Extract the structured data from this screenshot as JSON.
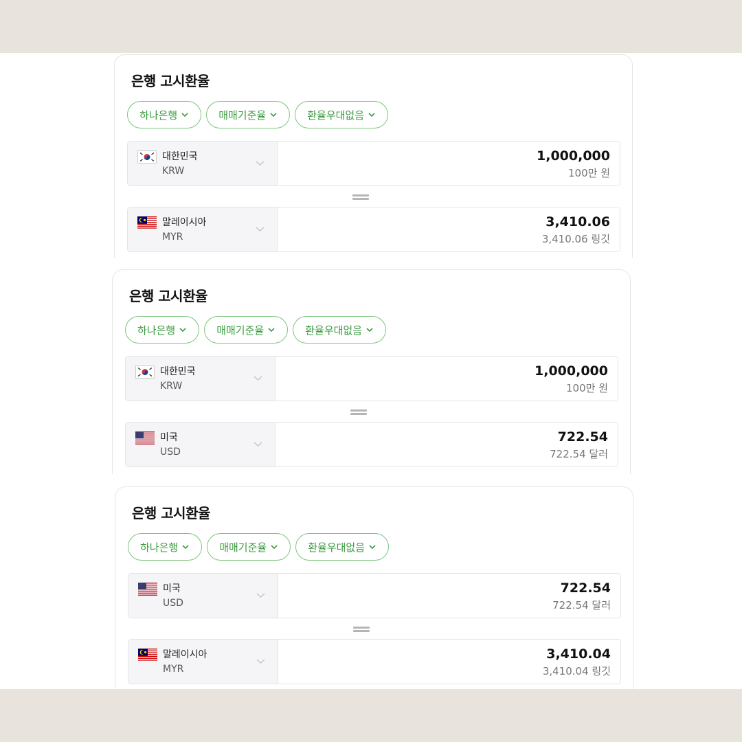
{
  "cards": [
    {
      "title": "은행 고시환율",
      "filters": [
        "하나은행",
        "매매기준율",
        "환율우대없음"
      ],
      "from": {
        "flag": "south-korea-flag-icon",
        "name": "대한민국",
        "code": "KRW",
        "amount": "1,000,000",
        "amount_text": "100만 원"
      },
      "to": {
        "flag": "malaysia-flag-icon",
        "name": "말레이시아",
        "code": "MYR",
        "amount": "3,410.06",
        "amount_text": "3,410.06 링깃"
      }
    },
    {
      "title": "은행 고시환율",
      "filters": [
        "하나은행",
        "매매기준율",
        "환율우대없음"
      ],
      "from": {
        "flag": "south-korea-flag-icon",
        "name": "대한민국",
        "code": "KRW",
        "amount": "1,000,000",
        "amount_text": "100만 원"
      },
      "to": {
        "flag": "usa-flag-icon",
        "name": "미국",
        "code": "USD",
        "amount": "722.54",
        "amount_text": "722.54 달러"
      }
    },
    {
      "title": "은행 고시환율",
      "filters": [
        "하나은행",
        "매매기준율",
        "환율우대없음"
      ],
      "from": {
        "flag": "usa-flag-icon",
        "name": "미국",
        "code": "USD",
        "amount": "722.54",
        "amount_text": "722.54 달러"
      },
      "to": {
        "flag": "malaysia-flag-icon",
        "name": "말레이시아",
        "code": "MYR",
        "amount": "3,410.04",
        "amount_text": "3,410.04 링깃"
      }
    }
  ],
  "colors": {
    "background": "#e8e3dc",
    "chip_border": "#7cc47c",
    "chip_text": "#3a9b3f",
    "select_bg": "#f5f5f7"
  }
}
